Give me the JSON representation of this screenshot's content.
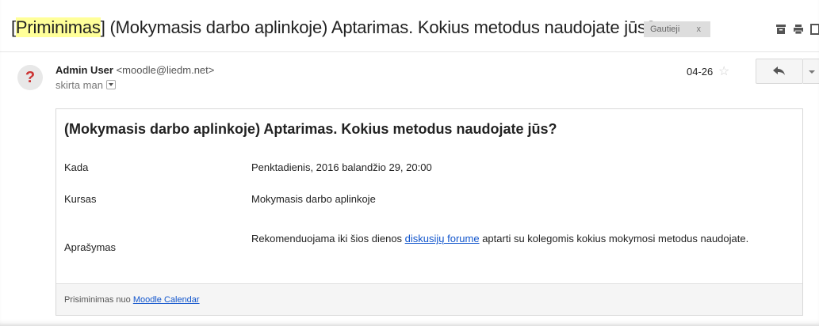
{
  "subject": {
    "highlighted": "Priminimas",
    "bracket_open": "[",
    "bracket_close": "]",
    "rest": " (Mokymasis darbo aplinkoje) Aptarimas. Kokius metodus naudojate jūs?"
  },
  "label": {
    "text": "Gautieji",
    "remove": "x"
  },
  "toolbar_icons": [
    "archive-icon",
    "print-icon",
    "new-window-icon"
  ],
  "sender": {
    "avatar_char": "?",
    "name": "Admin User",
    "email": "<moodle@liedm.net>",
    "to": "skirta man",
    "date": "04-26",
    "star": "☆"
  },
  "message": {
    "title": "(Mokymasis darbo aplinkoje) Aptarimas. Kokius metodus naudojate jūs?",
    "rows": [
      {
        "label": "Kada",
        "value": "Penktadienis, 2016 balandžio 29, 20:00"
      },
      {
        "label": "Kursas",
        "value": "Mokymasis darbo aplinkoje"
      },
      {
        "label": "Aprašymas",
        "value_before": "Rekomenduojama iki šios dienos ",
        "link": "diskusijų forume",
        "value_after": " aptarti su kolegomis kokius mokymosi metodus naudojate."
      }
    ],
    "footer_prefix": "Prisiminimas nuo ",
    "footer_link": "Moodle Calendar"
  },
  "colors": {
    "highlight": "#ffff99",
    "link": "#1155cc",
    "avatar_mark": "#cc3333"
  }
}
